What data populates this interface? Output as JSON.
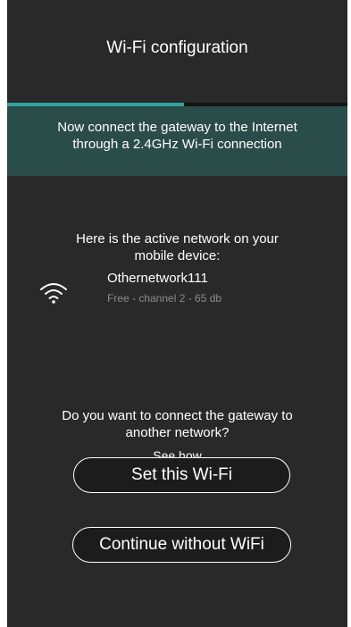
{
  "header": {
    "title": "Wi-Fi configuration"
  },
  "progress": {
    "fraction": 0.52,
    "fill_color": "#2fa39b"
  },
  "banner": {
    "line1": "Now connect the gateway to the Internet",
    "line2": "through a 2.4GHz Wi-Fi connection",
    "background": "#2b4d49"
  },
  "active_network": {
    "intro_line1": "Here is the active network on your",
    "intro_line2": "mobile device:",
    "icon": "wifi-icon",
    "name": "Othernetwork111",
    "detail": "Free - channel 2 - 65 db"
  },
  "question": {
    "line1": "Do you want to connect the gateway to",
    "line2": "another network?",
    "link": "See how"
  },
  "buttons": {
    "set_wifi": "Set this Wi-Fi",
    "continue_without": "Continue without WiFi"
  }
}
